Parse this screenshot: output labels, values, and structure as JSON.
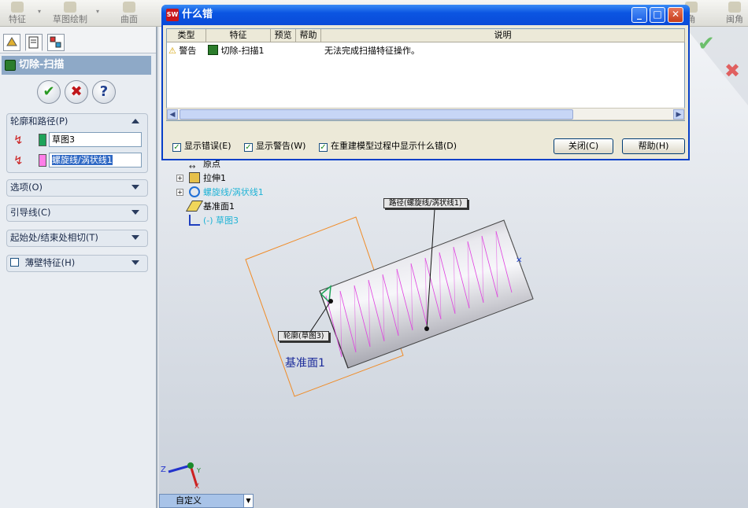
{
  "toolbar": {
    "items": [
      "特征",
      "草图绘制",
      "曲面"
    ],
    "right_items": [
      "角",
      "闽角"
    ]
  },
  "property_manager": {
    "title": "切除-扫描",
    "profile_path_group": {
      "label": "轮廓和路径(P)",
      "profile_value": "草图3",
      "path_value": "螺旋线/涡状线1"
    },
    "collapsed_groups": [
      "选项(O)",
      "引导线(C)",
      "起始处/结束处相切(T)"
    ],
    "thin_feature": {
      "label": "薄壁特征(H)",
      "checked": false
    }
  },
  "dialog": {
    "title": "什么错",
    "columns": [
      "类型",
      "特征",
      "预览",
      "帮助",
      "说明"
    ],
    "rows": [
      {
        "type": "警告",
        "feature": "切除-扫描1",
        "description": "无法完成扫描特征操作。"
      }
    ],
    "checkboxes": [
      {
        "label": "显示错误(E)",
        "checked": true
      },
      {
        "label": "显示警告(W)",
        "checked": true
      },
      {
        "label": "在重建模型过程中显示什么错(D)",
        "checked": true
      }
    ],
    "buttons": {
      "close": "关闭(C)",
      "help": "帮助(H)"
    }
  },
  "feature_tree": [
    {
      "label": "原点"
    },
    {
      "label": "拉伸1"
    },
    {
      "label": "螺旋线/涡状线1"
    },
    {
      "label": "基准面1"
    },
    {
      "label": "(-) 草图3"
    }
  ],
  "callouts": {
    "path": "路径(螺旋线/涡状线1)",
    "profile": "轮廓(草图3)"
  },
  "plane_label": "基准面1",
  "triad": {
    "z": "Z",
    "y": "Y",
    "x": "X"
  },
  "view_selector": "自定义",
  "colors": {
    "title_bar": "#0a4bd8",
    "helix": "#e040e0",
    "sketch_plane": "#f08a24",
    "profile_swatch": "#1ea35a",
    "path_swatch": "#ff7ee8"
  }
}
